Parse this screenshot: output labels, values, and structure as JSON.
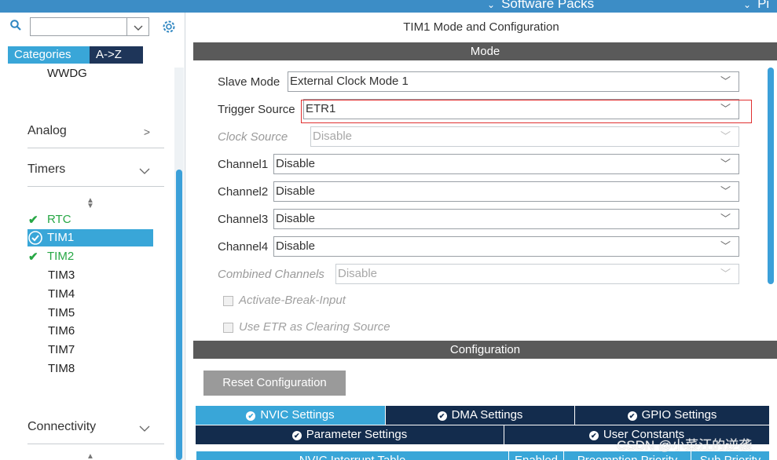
{
  "topbar": {
    "software_packs": "Software Packs",
    "pinout": "Pi"
  },
  "sidebar": {
    "tab_categories": "Categories",
    "tab_az": "A->Z",
    "wwdg": "WWDG",
    "group_analog": "Analog",
    "group_timers": "Timers",
    "group_connectivity": "Connectivity",
    "timers": [
      "RTC",
      "TIM1",
      "TIM2",
      "TIM3",
      "TIM4",
      "TIM5",
      "TIM6",
      "TIM7",
      "TIM8"
    ]
  },
  "main": {
    "title": "TIM1 Mode and Configuration",
    "mode_header": "Mode",
    "slave_mode": {
      "label": "Slave Mode",
      "value": "External Clock Mode 1"
    },
    "trigger_source": {
      "label": "Trigger Source",
      "value": "ETR1"
    },
    "clock_source": {
      "label": "Clock Source",
      "value": "Disable"
    },
    "channel1": {
      "label": "Channel1",
      "value": "Disable"
    },
    "channel2": {
      "label": "Channel2",
      "value": "Disable"
    },
    "channel3": {
      "label": "Channel3",
      "value": "Disable"
    },
    "channel4": {
      "label": "Channel4",
      "value": "Disable"
    },
    "combined_channels": {
      "label": "Combined Channels",
      "value": "Disable"
    },
    "activate_break_input": "Activate-Break-Input",
    "use_etr_clearing": "Use ETR as Clearing Source",
    "config_header": "Configuration",
    "reset_button": "Reset Configuration",
    "tabs": {
      "nvic": "NVIC Settings",
      "dma": "DMA Settings",
      "gpio": "GPIO Settings",
      "parameter": "Parameter Settings",
      "user_constants": "User Constants"
    },
    "table_headers": {
      "nvic_table": "NVIC Interrupt Table",
      "enabled": "Enabled",
      "preemption": "Preemption Priority",
      "sub_priority": "Sub Priority"
    },
    "watermark": "CSDN @小菜汪的逆袭"
  }
}
